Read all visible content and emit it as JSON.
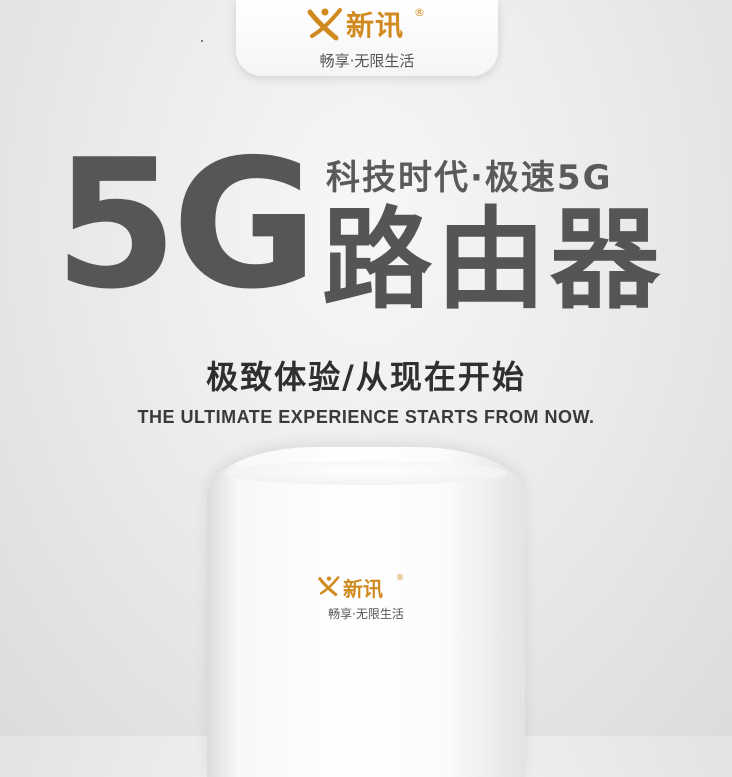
{
  "brand": {
    "name": "新讯",
    "registered": "®",
    "slogan": "畅享·无限生活"
  },
  "headline": {
    "big": "5G",
    "tagline": "科技时代·极速5G",
    "product": "路由器"
  },
  "subtitle_cn": "极致体验/从现在开始",
  "subtitle_en": "THE ULTIMATE EXPERIENCE STARTS FROM NOW.",
  "device_logo": {
    "name": "新讯",
    "registered": "®",
    "slogan": "畅享·无限生活"
  },
  "colors": {
    "brand": "#d18a1f",
    "headline": "#565656",
    "background": "#ececec"
  }
}
